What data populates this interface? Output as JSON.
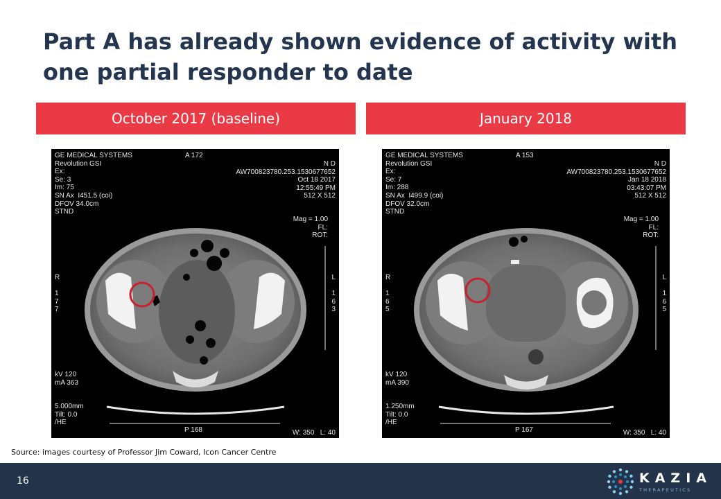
{
  "slide": {
    "title_line1": "Part A has already shown evidence of activity with",
    "title_line2": "one partial responder to date",
    "page_number": "16",
    "source": "Source: images courtesy of Professor Jim Coward, Icon Cancer Centre"
  },
  "panels": [
    {
      "banner": "October 2017 (baseline)",
      "overlay": {
        "top_left": "GE MEDICAL SYSTEMS\nRevolution GSI\nEx:\nSe: 3\nIm: 75\nSN Ax  I451.5 (coi)\nDFOV 34.0cm\nSTND",
        "top_center": "A 172",
        "top_right": "N D\nAW700823780.253.1530677652\nOct 18 2017\n12:55:49 PM\n512 X 512",
        "mid_right": "Mag = 1.00\nFL:\nROT:",
        "side_left": "R\n\n1\n7\n7",
        "side_right": "L\n\n1\n6\n3",
        "bottom_left": "kV 120\nmA 363",
        "bottom_left2": "5.000mm\nTilt: 0.0\n/HE",
        "bottom_center": "P 168",
        "bottom_right": "W: 350   L: 40"
      }
    },
    {
      "banner": "January 2018",
      "overlay": {
        "top_left": "GE MEDICAL SYSTEMS\nRevolution GSI\nEx:\nSe: 7\nIm: 288\nSN Ax  I499.9 (coi)\nDFOV 32.0cm\nSTND",
        "top_center": "A 153",
        "top_right": "N D\nAW700823780.253.1530677652\nJan 18 2018\n03:43:07 PM\n512 X 512",
        "mid_right": "Mag = 1.00\nFL:\nROT:",
        "side_left": "R\n\n1\n6\n5",
        "side_right": "L\n\n1\n6\n5",
        "bottom_left": "kV 120\nmA 390",
        "bottom_left2": "1.250mm\nTilt: 0.0\n/HE",
        "bottom_center": "P 167",
        "bottom_right": "W: 350   L: 40"
      }
    }
  ],
  "logo": {
    "name": "KAZIA",
    "tagline": "THERAPEUTICS"
  },
  "colors": {
    "title": "#24364f",
    "banner": "#ea3a45",
    "footer": "#23344a",
    "highlight_circle": "#c8202c"
  }
}
